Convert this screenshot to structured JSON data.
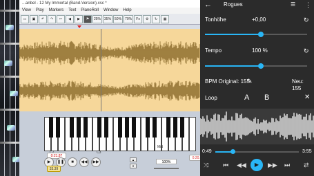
{
  "desktop": {
    "title": "...anbel - 12 My Immortal (Band-Version).xsc *",
    "menu": [
      "View",
      "Play",
      "Markers",
      "Text",
      "PianoRoll",
      "Window",
      "Help"
    ],
    "toolbar": [
      "25%",
      "35%",
      "50%",
      "70%",
      "Fx"
    ],
    "piano_labels": [
      "C2",
      "C3",
      "Mid"
    ],
    "time_a": "0:21.87",
    "time_b": "33.39",
    "time_c": "0:20.93",
    "percent": "100%"
  },
  "phone": {
    "title": "Rogues",
    "pitch": {
      "label": "Tonhöhe",
      "value": "+0,00",
      "level": 0.55
    },
    "tempo": {
      "label": "Tempo",
      "value": "100 %",
      "level": 0.55
    },
    "bpm_original": "BPM Original: 155",
    "bpm_new": "Neu: 155",
    "loop": {
      "label": "Loop",
      "a": "A",
      "b": "B"
    },
    "position": "0:49",
    "duration": "3:55",
    "progress": 0.21,
    "accent": "#29b6f6"
  },
  "icons": {
    "back": "back-arrow-icon",
    "queue": "queue-icon",
    "more": "more-vert-icon",
    "reset": "reset-icon",
    "edit": "pencil-icon",
    "close": "close-icon",
    "play": "play-icon",
    "shuffle": "shuffle-icon",
    "repeat": "repeat-icon"
  }
}
